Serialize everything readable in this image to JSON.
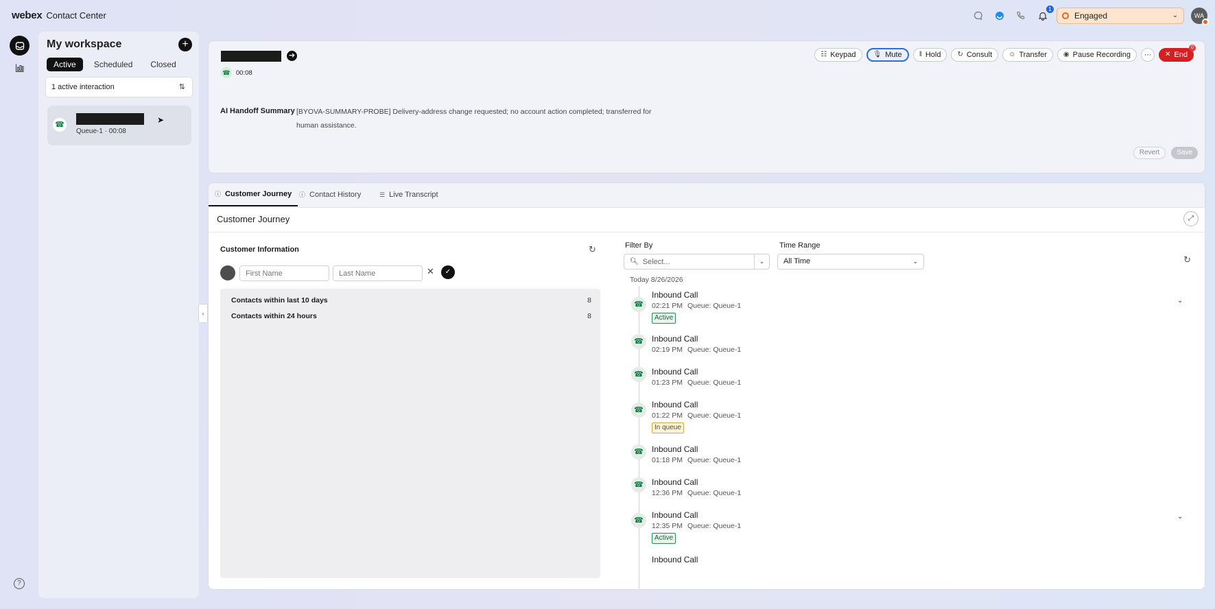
{
  "app": {
    "logo": "webex",
    "product": "Contact Center"
  },
  "topbar": {
    "notifications_count": "1",
    "agent_state": "Engaged",
    "avatar_initials": "WA"
  },
  "workspace": {
    "title": "My workspace",
    "tabs": [
      "Active",
      "Scheduled",
      "Closed"
    ],
    "interaction_count": "1 active interaction",
    "card": {
      "meta": "Queue-1 · 00:08"
    }
  },
  "contact": {
    "timer": "00:08",
    "controls": {
      "keypad": "Keypad",
      "mute": "Mute",
      "hold": "Hold",
      "consult": "Consult",
      "transfer": "Transfer",
      "pause_recording": "Pause Recording",
      "more": "···",
      "end": "End"
    },
    "handoff_label": "AI Handoff Summary",
    "handoff_text": "[BYOVA-SUMMARY-PROBE] Delivery-address change requested; no account action completed; transferred for human assistance.",
    "revert": "Revert",
    "save": "Save"
  },
  "tabs": [
    "Customer Journey",
    "Contact History",
    "Live Transcript"
  ],
  "journey": {
    "title": "Customer Journey",
    "customer_info_label": "Customer Information",
    "first_name_placeholder": "First Name",
    "last_name_placeholder": "Last Name",
    "stats": [
      {
        "label": "Contacts within last 10 days",
        "value": "8"
      },
      {
        "label": "Contacts within 24 hours",
        "value": "8"
      }
    ],
    "filter_label": "Filter By",
    "filter_placeholder": "Select...",
    "time_range_label": "Time Range",
    "time_range_value": "All Time",
    "date_label": "Today 8/26/2026",
    "events": [
      {
        "title": "Inbound Call",
        "time": "02:21 PM",
        "queue": "Queue: Queue-1",
        "status": "Active"
      },
      {
        "title": "Inbound Call",
        "time": "02:19 PM",
        "queue": "Queue: Queue-1",
        "status": ""
      },
      {
        "title": "Inbound Call",
        "time": "01:23 PM",
        "queue": "Queue: Queue-1",
        "status": ""
      },
      {
        "title": "Inbound Call",
        "time": "01:22 PM",
        "queue": "Queue: Queue-1",
        "status": "In queue"
      },
      {
        "title": "Inbound Call",
        "time": "01:18 PM",
        "queue": "Queue: Queue-1",
        "status": ""
      },
      {
        "title": "Inbound Call",
        "time": "12:36 PM",
        "queue": "Queue: Queue-1",
        "status": ""
      },
      {
        "title": "Inbound Call",
        "time": "12:35 PM",
        "queue": "Queue: Queue-1",
        "status": "Active"
      },
      {
        "title": "Inbound Call",
        "time": "",
        "queue": "",
        "status": ""
      }
    ]
  },
  "colors": {
    "accent": "#2c6ed6",
    "end_button": "#d61f23",
    "engaged": "#e1681c",
    "active_pill": "#2c8a55",
    "queue_pill": "#d6a93a"
  },
  "icons": {
    "top": [
      "chat-icon",
      "webex-icon",
      "phone-icon",
      "bell-icon"
    ],
    "nav": [
      "inbox-icon",
      "analytics-icon",
      "help-icon"
    ]
  }
}
